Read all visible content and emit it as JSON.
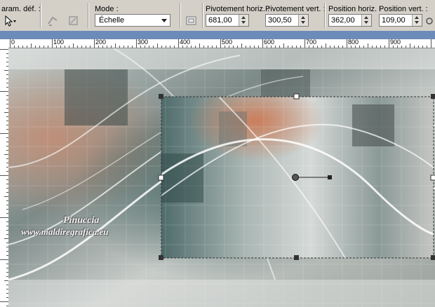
{
  "toolbar": {
    "param_label": "aram. déf. :",
    "mode_label": "Mode :",
    "mode_value": "Échelle",
    "pivot_h_label": "Pivotement horiz. :",
    "pivot_h_value": "681,00",
    "pivot_v_label": "Pivotement vert. :",
    "pivot_v_value": "300,50",
    "pos_h_label": "Position horiz. :",
    "pos_h_value": "362,00",
    "pos_v_label": "Position vert. :",
    "pos_v_value": "109,00"
  },
  "ruler": {
    "labels": [
      "0",
      "100",
      "200",
      "300",
      "400",
      "500",
      "600",
      "700",
      "800",
      "900"
    ]
  },
  "watermark": {
    "line1": "Pinuccia",
    "line2": "www.maldiregrafica.eu"
  },
  "colors": {
    "toolbar_bg": "#d4d0c8",
    "selection_handle": "#333333"
  }
}
